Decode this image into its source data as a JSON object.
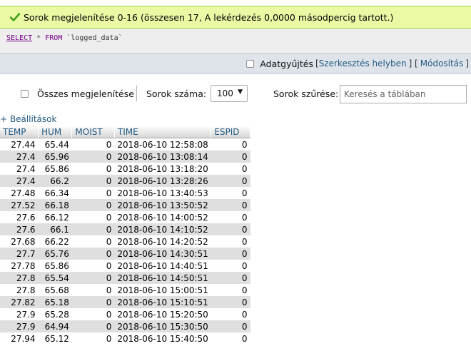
{
  "success_message": "Sorok megjelenítése 0-16 (összesen 17, A lekérdezés 0,0000 másodpercig tartott.)",
  "sql": {
    "select": "SELECT",
    "star": "*",
    "from": "FROM",
    "table": "`logged_data`"
  },
  "ops": {
    "collect_label": "Adatgyűjtés",
    "bracket_open": "[",
    "edit_inline": "Szerkesztés helyben",
    "mid": "] [",
    "modify": "Módosítás",
    "bracket_close": "]"
  },
  "controls": {
    "show_all_label": "Összes megjelenítése",
    "row_count_label": "Sorok száma:",
    "row_count_value": "100",
    "filter_label": "Sorok szűrése:",
    "filter_placeholder": "Keresés a táblában"
  },
  "settings_link": "+ Beállítások",
  "table": {
    "headers": [
      "TEMP",
      "HUM",
      "MOIST",
      "TIME",
      "ESPID"
    ],
    "rows": [
      [
        "27.44",
        "65.44",
        "0",
        "2018-06-10 12:58:08",
        "0"
      ],
      [
        "27.4",
        "65.96",
        "0",
        "2018-06-10 13:08:14",
        "0"
      ],
      [
        "27.4",
        "65.86",
        "0",
        "2018-06-10 13:18:20",
        "0"
      ],
      [
        "27.4",
        "66.2",
        "0",
        "2018-06-10 13:28:26",
        "0"
      ],
      [
        "27.48",
        "66.34",
        "0",
        "2018-06-10 13:40:53",
        "0"
      ],
      [
        "27.52",
        "66.18",
        "0",
        "2018-06-10 13:50:52",
        "0"
      ],
      [
        "27.6",
        "66.12",
        "0",
        "2018-06-10 14:00:52",
        "0"
      ],
      [
        "27.6",
        "66.1",
        "0",
        "2018-06-10 14:10:52",
        "0"
      ],
      [
        "27.68",
        "66.22",
        "0",
        "2018-06-10 14:20:52",
        "0"
      ],
      [
        "27.7",
        "65.76",
        "0",
        "2018-06-10 14:30:51",
        "0"
      ],
      [
        "27.78",
        "65.86",
        "0",
        "2018-06-10 14:40:51",
        "0"
      ],
      [
        "27.8",
        "65.54",
        "0",
        "2018-06-10 14:50:51",
        "0"
      ],
      [
        "27.8",
        "65.68",
        "0",
        "2018-06-10 15:00:51",
        "0"
      ],
      [
        "27.82",
        "65.18",
        "0",
        "2018-06-10 15:10:51",
        "0"
      ],
      [
        "27.9",
        "65.28",
        "0",
        "2018-06-10 15:20:50",
        "0"
      ],
      [
        "27.9",
        "64.94",
        "0",
        "2018-06-10 15:30:50",
        "0"
      ],
      [
        "27.94",
        "65.12",
        "0",
        "2018-06-10 15:40:50",
        "0"
      ]
    ]
  },
  "colors": {
    "success_bg": "#ebf8a4",
    "link": "#235a81",
    "row_alt": "#dfdfdf"
  },
  "icons": {
    "success": "checkmark-icon",
    "dropdown": "caret-down-icon"
  }
}
